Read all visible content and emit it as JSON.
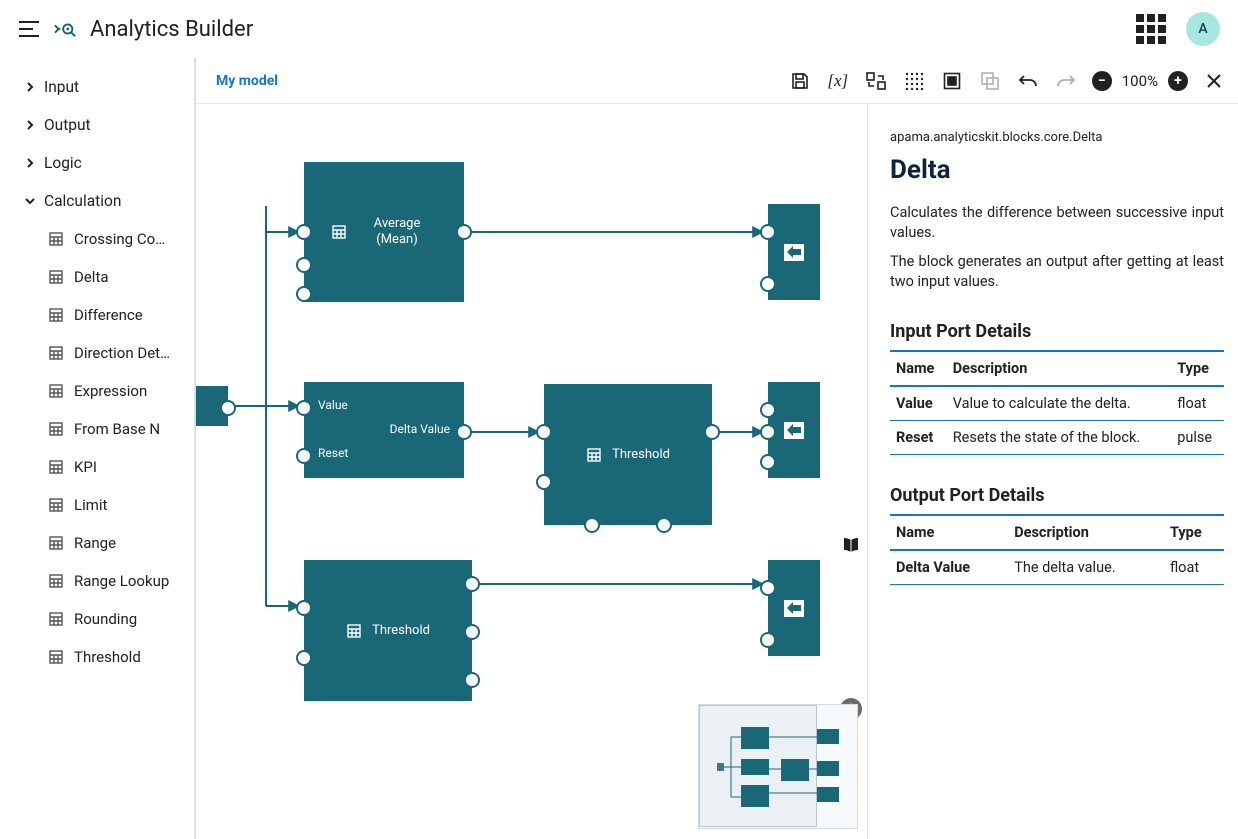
{
  "header": {
    "title": "Analytics Builder",
    "avatar_initial": "A"
  },
  "sidebar": {
    "categories": [
      {
        "label": "Input",
        "expanded": false
      },
      {
        "label": "Output",
        "expanded": false
      },
      {
        "label": "Logic",
        "expanded": false
      },
      {
        "label": "Calculation",
        "expanded": true,
        "children": [
          "Crossing Co…",
          "Delta",
          "Difference",
          "Direction Det…",
          "Expression",
          "From Base N",
          "KPI",
          "Limit",
          "Range",
          "Range Lookup",
          "Rounding",
          "Threshold"
        ]
      }
    ]
  },
  "model_bar": {
    "title": "My model",
    "zoom_label": "100%"
  },
  "canvas": {
    "input_node": {
      "label": ""
    },
    "avg_node": {
      "label": "Average (Mean)"
    },
    "delta_node": {
      "in_value": "Value",
      "in_reset": "Reset",
      "out_label": "Delta Value"
    },
    "threshold_node_center": {
      "label": "Threshold"
    },
    "threshold_node_bottom": {
      "label": "Threshold"
    }
  },
  "details": {
    "full_path": "apama.analyticskit.blocks.core.Delta",
    "title": "Delta",
    "p1": "Calculates the difference between successive input values.",
    "p2": "The block generates an output after getting at least two input values.",
    "input_section_title": "Input Port Details",
    "output_section_title": "Output Port Details",
    "headers": {
      "name": "Name",
      "description": "Description",
      "type": "Type"
    },
    "inputs": [
      {
        "name": "Value",
        "desc": "Value to calculate the delta.",
        "type": "float"
      },
      {
        "name": "Reset",
        "desc": "Resets the state of the block.",
        "type": "pulse"
      }
    ],
    "outputs": [
      {
        "name": "Delta Value",
        "desc": "The delta value.",
        "type": "float"
      }
    ]
  }
}
